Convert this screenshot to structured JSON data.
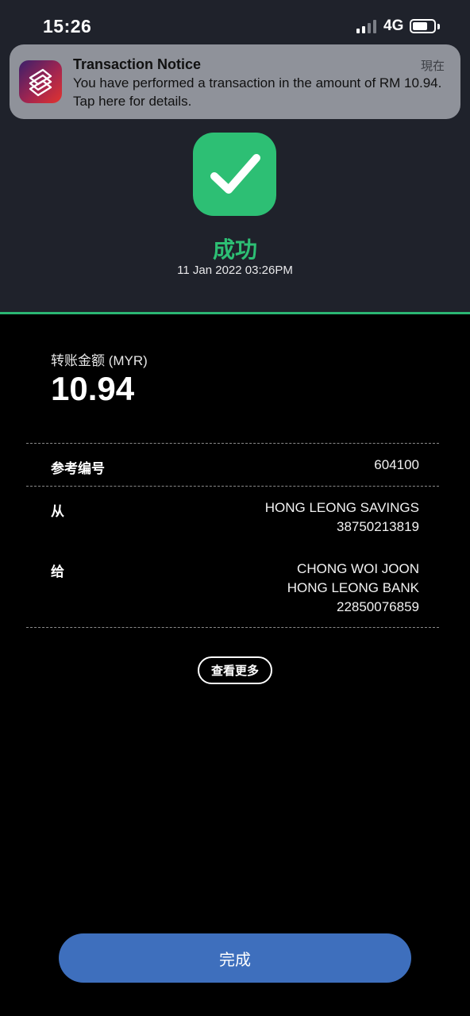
{
  "status_bar": {
    "time": "15:26",
    "network": "4G",
    "signal_bars_active": 2,
    "signal_bars_total": 4
  },
  "notification": {
    "title": "Transaction Notice",
    "time": "現在",
    "body": "You have performed a transaction in the amount of RM 10.94. Tap here for details.",
    "app_icon": "bank-app-icon"
  },
  "result": {
    "icon": "check-icon",
    "status": "成功",
    "datetime": "11 Jan 2022 03:26PM",
    "accent_color": "#2dbf74"
  },
  "transfer": {
    "amount_label": "转账金额 (MYR)",
    "amount": "10.94",
    "reference": {
      "label": "参考编号",
      "value": "604100"
    },
    "from": {
      "label": "从",
      "account_name": "HONG LEONG SAVINGS",
      "account_number": "38750213819"
    },
    "to": {
      "label": "给",
      "recipient": "CHONG WOI JOON",
      "bank": "HONG LEONG BANK",
      "account_number": "22850076859"
    }
  },
  "actions": {
    "view_more": "查看更多",
    "done": "完成",
    "done_color": "#3e6fbd"
  }
}
